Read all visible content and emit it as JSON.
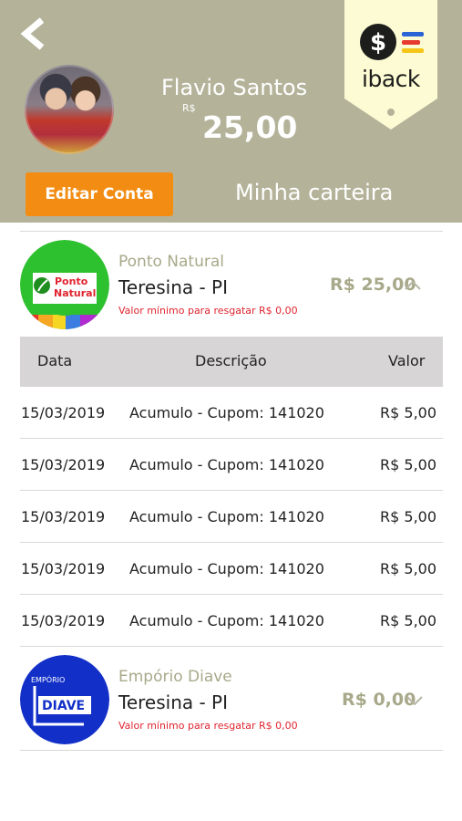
{
  "header": {
    "user_name": "Flavio Santos",
    "currency_symbol": "R$",
    "balance": "25,00",
    "edit_button_label": "Editar Conta",
    "wallet_title": "Minha carteira",
    "logo_text": "iback",
    "background_color": "#b4b39a"
  },
  "table": {
    "columns": [
      "Data",
      "Descrição",
      "Valor"
    ],
    "rows": [
      {
        "date": "15/03/2019",
        "description": "Acumulo - Cupom: 141020",
        "value": "R$ 5,00"
      },
      {
        "date": "15/03/2019",
        "description": "Acumulo - Cupom: 141020",
        "value": "R$ 5,00"
      },
      {
        "date": "15/03/2019",
        "description": "Acumulo - Cupom: 141020",
        "value": "R$ 5,00"
      },
      {
        "date": "15/03/2019",
        "description": "Acumulo - Cupom: 141020",
        "value": "R$ 5,00"
      },
      {
        "date": "15/03/2019",
        "description": "Acumulo - Cupom: 141020",
        "value": "R$ 5,00"
      }
    ]
  },
  "stores": [
    {
      "brand": "Ponto Natural",
      "logo_text_line1": "Ponto",
      "logo_text_line2": "Natural",
      "city": "Teresina - PI",
      "min_redeem": "Valor mínimo para resgatar R$ 0,00",
      "amount": "R$ 25,00",
      "expanded": true
    },
    {
      "brand": "Empório Diave",
      "logo_text_line1": "EMPÓRIO",
      "logo_text_line2": "DIAVE",
      "city": "Teresina - PI",
      "min_redeem": "Valor mínimo para resgatar R$ 0,00",
      "amount": "R$ 0,00",
      "expanded": false
    }
  ],
  "icons": {
    "back": "chevron-left-icon",
    "expand": "chevron-up-icon",
    "collapse": "chevron-down-icon",
    "logo": "dollar-coin-icon"
  },
  "colors": {
    "accent_orange": "#f28c12",
    "muted_olive": "#a8a98a",
    "warning_red": "#e0242f",
    "ponto_green": "#2ec12f",
    "diave_blue": "#1230c8"
  }
}
